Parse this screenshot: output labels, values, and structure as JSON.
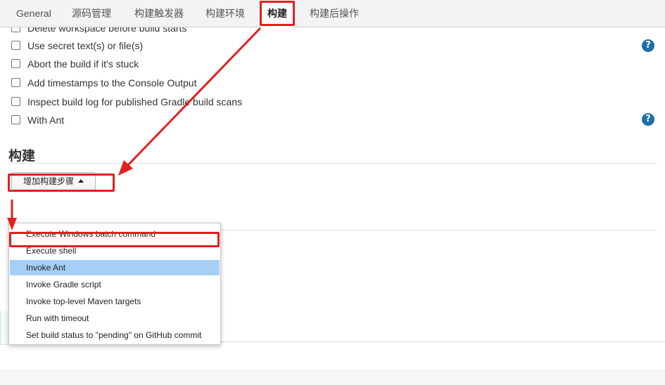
{
  "tabs": [
    {
      "label": "General"
    },
    {
      "label": "源码管理"
    },
    {
      "label": "构建触发器"
    },
    {
      "label": "构建环境"
    },
    {
      "label": "构建"
    },
    {
      "label": "构建后操作"
    }
  ],
  "build_environment": {
    "options": [
      {
        "label": "Delete workspace before build starts"
      },
      {
        "label": "Use secret text(s) or file(s)"
      },
      {
        "label": "Abort the build if it's stuck"
      },
      {
        "label": "Add timestamps to the Console Output"
      },
      {
        "label": "Inspect build log for published Gradle build scans"
      },
      {
        "label": "With Ant"
      }
    ],
    "help_glyph": "?"
  },
  "build_section": {
    "title": "构建",
    "add_step_label": "增加构建步骤"
  },
  "dropdown": {
    "items": [
      {
        "label": "Execute Windows batch command"
      },
      {
        "label": "Execute shell"
      },
      {
        "label": "Invoke Ant"
      },
      {
        "label": "Invoke Gradle script"
      },
      {
        "label": "Invoke top-level Maven targets"
      },
      {
        "label": "Run with timeout"
      },
      {
        "label": "Set build status to \"pending\" on GitHub commit"
      }
    ],
    "highlighted_item": "Invoke Ant"
  },
  "colors": {
    "annotation_red": "#e02020",
    "highlight_blue": "#a6cff5",
    "help_blue": "#1d6fa8",
    "save_blue": "#2a7ab8"
  }
}
